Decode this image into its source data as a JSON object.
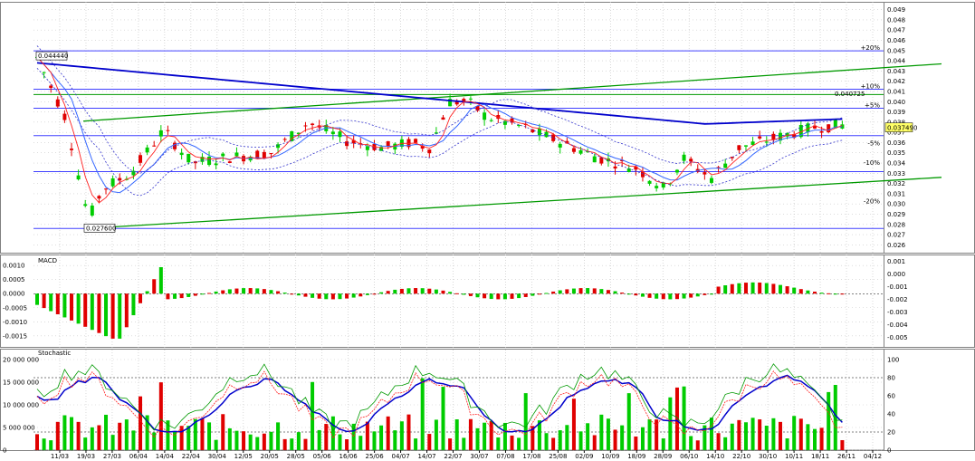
{
  "colors": {
    "background": "#ffffff",
    "grid": "#c8c8c8",
    "up": "#00cc00",
    "down": "#e00000",
    "sma_long": "#0000cc",
    "sma_short": "#3366ff",
    "ema": "#ff2020",
    "channel": "#009900",
    "hline": "#4040ff",
    "dotted_band": "#3333cc"
  },
  "x_labels": [
    "11/03",
    "19/03",
    "27/03",
    "06/04",
    "14/04",
    "22/04",
    "30/04",
    "12/05",
    "20/05",
    "28/05",
    "05/06",
    "16/06",
    "25/06",
    "04/07",
    "14/07",
    "22/07",
    "30/07",
    "07/08",
    "17/08",
    "25/08",
    "02/09",
    "10/09",
    "18/09",
    "28/09",
    "06/10",
    "14/10",
    "22/10",
    "30/10",
    "10/11",
    "18/11",
    "26/11",
    "04/12"
  ],
  "chart_data": [
    {
      "type": "candlestick",
      "title": "",
      "y_ticks": [
        "0.049",
        "0.048",
        "0.047",
        "0.046",
        "0.045",
        "0.044",
        "0.043",
        "0.042",
        "0.041",
        "0.040",
        "0.039",
        "0.038",
        "0.037",
        "0.036",
        "0.035",
        "0.034",
        "0.033",
        "0.032",
        "0.031",
        "0.030",
        "0.029",
        "0.028",
        "0.027",
        "0.026"
      ],
      "ylim": [
        0.0255,
        0.0495
      ],
      "last_price_label": "0.037490",
      "last_price": 0.03749,
      "annotations": [
        {
          "text": "0.044440",
          "value": 0.04444
        },
        {
          "text": "0.027600",
          "value": 0.0276
        },
        {
          "text": "0.040725",
          "value": 0.040725
        }
      ],
      "percent_levels": [
        {
          "text": "+20%",
          "value": 0.04497
        },
        {
          "text": "+10%",
          "value": 0.04122
        },
        {
          "text": "+5%",
          "value": 0.03936
        },
        {
          "text": "-5%",
          "value": 0.03562
        },
        {
          "text": "-10%",
          "value": 0.03374
        },
        {
          "text": "-20%",
          "value": 0.02999
        }
      ],
      "horizontal_lines": [
        0.04497,
        0.04122,
        0.03936,
        0.03668,
        0.03316,
        0.0276
      ],
      "support_line": [
        {
          "x": "11/03",
          "y": 0.04444
        },
        {
          "x": "04/12",
          "y": 0.0437
        }
      ],
      "channel_lower": [
        {
          "x": "27/03",
          "y": 0.0276
        },
        {
          "x": "04/12",
          "y": 0.0326
        }
      ],
      "channel_upper": [
        {
          "x": "19/03",
          "y": 0.0381
        },
        {
          "x": "04/12",
          "y": 0.0437
        }
      ]
    },
    {
      "type": "bar",
      "title": "MACD",
      "y_ticks_left": [
        "0.0010",
        "0.0005",
        "0.0000",
        "-0.0005",
        "-0.0010",
        "-0.0015"
      ],
      "y_ticks_right": [
        "0.001",
        "0.000",
        "-0.001",
        "-0.002",
        "-0.003",
        "-0.004",
        "-0.005"
      ],
      "ylim": [
        -0.0017,
        0.0012
      ]
    },
    {
      "type": "bar",
      "title": "Stochastic",
      "y_ticks_left": [
        "20 000 000",
        "15 000 000",
        "10 000 000",
        "5 000 000",
        "0"
      ],
      "y_ticks_right": [
        "100",
        "80",
        "60",
        "40",
        "20",
        "0"
      ],
      "ylim_volume": [
        0,
        20000000
      ],
      "ylim_stochastic": [
        0,
        100
      ]
    }
  ]
}
